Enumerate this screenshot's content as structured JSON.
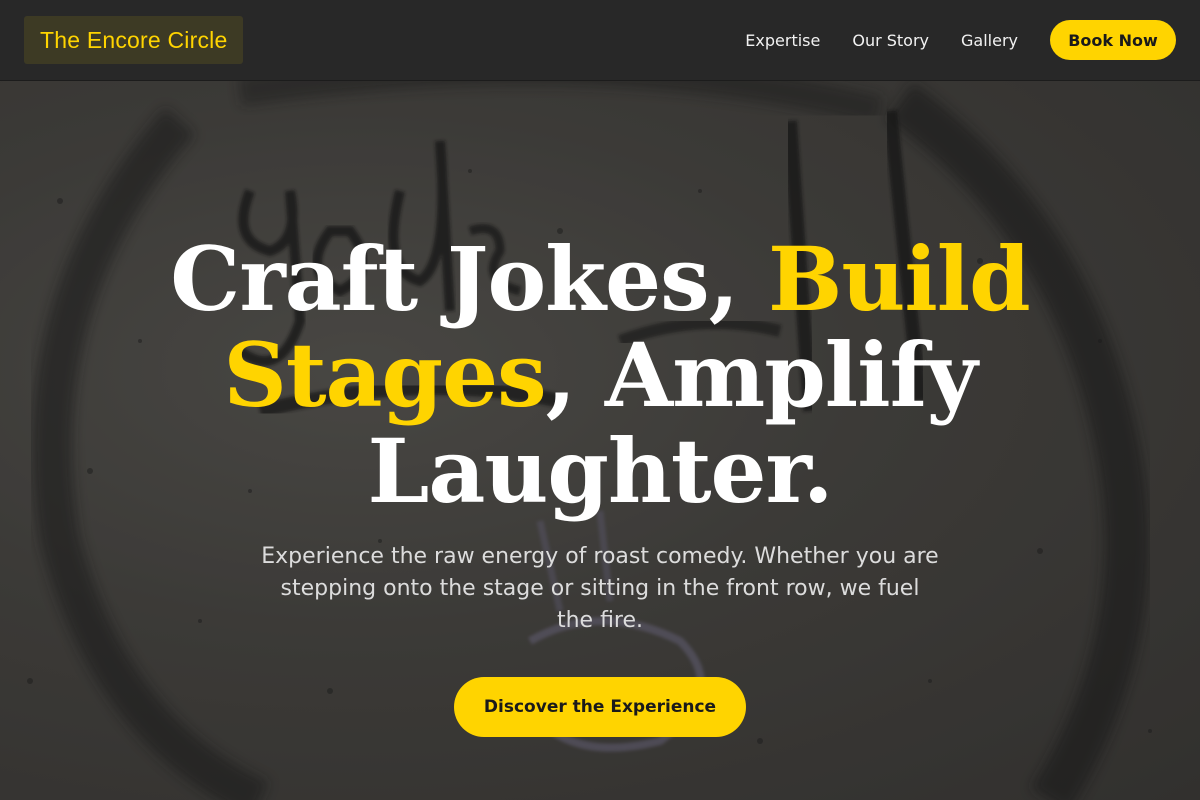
{
  "header": {
    "logo": "The Encore Circle",
    "nav": [
      {
        "label": "Expertise"
      },
      {
        "label": "Our Story"
      },
      {
        "label": "Gallery"
      }
    ],
    "book_label": "Book Now"
  },
  "hero": {
    "headline_part1": "Craft Jokes, ",
    "headline_accent": "Build Stages",
    "headline_part2": ", Amplify Laughter.",
    "subtext": "Experience the raw energy of roast comedy. Whether you are stepping onto the stage or sitting in the front row, we fuel the fire.",
    "cta_label": "Discover the Experience"
  },
  "colors": {
    "accent": "#ffd400",
    "header_bg": "#282828",
    "text_light": "#ffffff"
  },
  "icons": {
    "background": "graffiti-wall-image"
  }
}
